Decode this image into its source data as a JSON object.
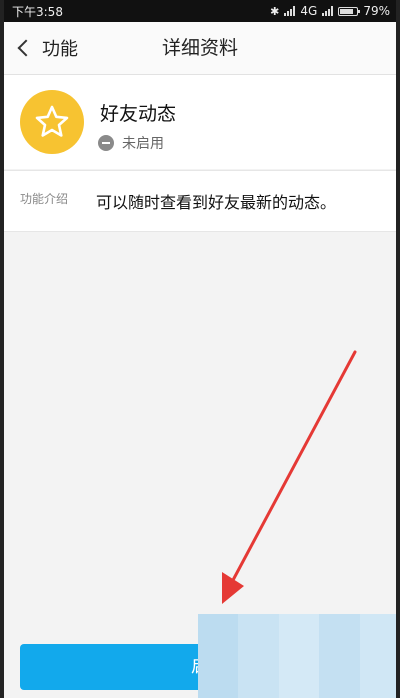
{
  "status_bar": {
    "time": "下午3:58",
    "network": "4G",
    "battery": "79%",
    "battery_level": 0.79
  },
  "nav": {
    "back_label": "功能",
    "title": "详细资料"
  },
  "feature": {
    "name": "好友动态",
    "status": "未启用"
  },
  "intro": {
    "label": "功能介绍",
    "text": "可以随时查看到好友最新的动态。"
  },
  "action": {
    "button_label": "启"
  },
  "colors": {
    "accent": "#12a9ec",
    "avatar_bg": "#f7c331",
    "arrow": "#e53935"
  }
}
